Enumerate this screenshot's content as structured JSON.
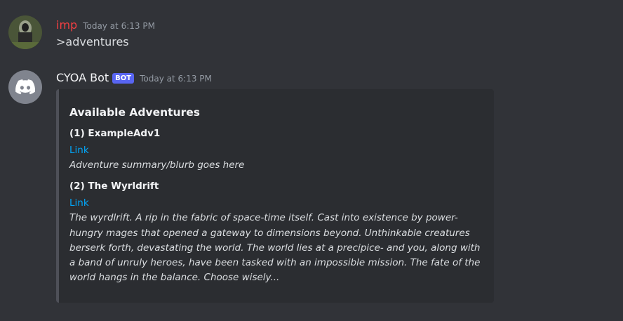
{
  "messages": [
    {
      "author": "imp",
      "author_color": "#f23f42",
      "timestamp": "Today at 6:13 PM",
      "content": ">adventures"
    },
    {
      "author": "CYOA Bot",
      "author_color": "#f2f3f5",
      "bot_tag": "BOT",
      "timestamp": "Today at 6:13 PM",
      "embed": {
        "title": "Available Adventures",
        "fields": [
          {
            "name": "(1) ExampleAdv1",
            "link": "Link",
            "value": "Adventure summary/blurb goes here"
          },
          {
            "name": "(2) The Wyrldrift",
            "link": "Link",
            "value": "The wyrdlrift. A rip in the fabric of space-time itself. Cast into existence by power-hungry mages that opened a gateway to dimensions beyond. Unthinkable creatures berserk forth, devastating the world. The world lies at a precipice- and you, along with a band of unruly heroes, have been tasked with an impossible mission. The fate of the world hangs in the balance. Choose wisely..."
          }
        ]
      }
    }
  ],
  "icons": {
    "user_avatar": "user-avatar",
    "bot_avatar": "discord-logo-icon"
  }
}
